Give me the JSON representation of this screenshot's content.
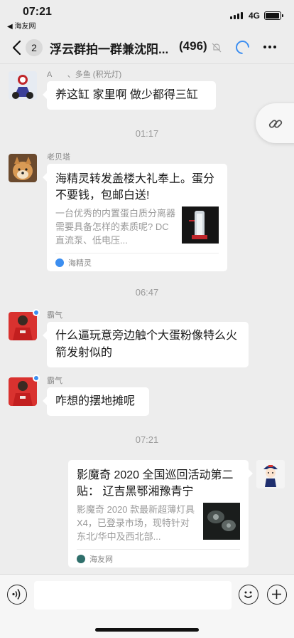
{
  "status_bar": {
    "time": "07:21",
    "back_app": "◀ 海友网",
    "network": "4G"
  },
  "nav": {
    "unread_count": "2",
    "title": "浮云群拍一群兼沈阳...",
    "member_count": "(496)"
  },
  "messages": [
    {
      "sender": "A　　、多鱼 (积光灯)",
      "text": "养这缸 家里啊 做少都得三缸"
    },
    {
      "divider": "01:17"
    },
    {
      "sender": "老贝塔",
      "card": {
        "title": "海精灵转发盖楼大礼奉上。蛋分不要钱，包邮白送!",
        "desc": "一台优秀的内置蛋白质分离器需要具备怎样的素质呢? DC直流泵、低电压...",
        "source": "海精灵"
      }
    },
    {
      "divider": "06:47"
    },
    {
      "sender": "霸气",
      "text": "什么逼玩意旁边触个大蛋粉像特么火箭发射似的"
    },
    {
      "sender": "霸气",
      "text": "咋想的摆地摊呢"
    },
    {
      "divider": "07:21"
    },
    {
      "card": {
        "title": "影魔奇 2020 全国巡回活动第二贴： 辽吉黑鄂湘豫青宁",
        "desc": "影魔奇 2020 款最新超薄灯具 X4，已登录市场，现特针对东北/华中及西北部...",
        "source": "海友网"
      }
    }
  ],
  "colors": {
    "accent": "#3c8ef0",
    "background": "#ededed"
  }
}
